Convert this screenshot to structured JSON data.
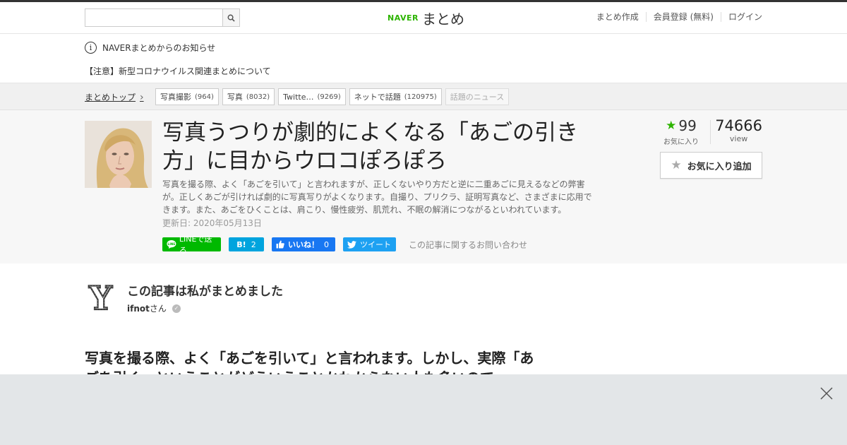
{
  "header": {
    "search_placeholder": "",
    "logo_naver": "NAVER",
    "logo_matome": "まとめ",
    "nav": [
      "まとめ作成",
      "会員登録 (無料)",
      "ログイン"
    ]
  },
  "notice": {
    "info_glyph": "i",
    "heading": "NAVERまとめからのお知らせ",
    "item": "【注意】新型コロナウイルス関連まとめについて"
  },
  "breadcrumb": {
    "top": "まとめトップ",
    "tags": [
      {
        "label": "写真撮影",
        "count": "(964)"
      },
      {
        "label": "写真",
        "count": "(8032)"
      },
      {
        "label": "Twitte…",
        "count": "(9269)"
      },
      {
        "label": "ネットで話題",
        "count": "(120975)"
      },
      {
        "label": "話題のニュース",
        "count": ""
      }
    ]
  },
  "article": {
    "title": "写真うつりが劇的によくなる「あごの引き方」に目からウロコぽろぽろ",
    "description": "写真を撮る際、よく「あごを引いて」と言われますが、正しくないやり方だと逆に二重あごに見えるなどの弊害が。正しくあごが引ければ劇的に写真写りがよくなります。自撮り、プリクラ、証明写真など、さまざまに応用できます。また、あごをひくことは、肩こり、慢性疲労、肌荒れ、不眠の解消につながるといわれています。",
    "updated": "更新日: 2020年05月13日",
    "favorites": "99",
    "favorites_label": "お気に入り",
    "views": "74666",
    "views_label": "view",
    "fav_button": "お気に入り追加"
  },
  "social": {
    "line": "LINEで送る",
    "hatena_mark": "B!",
    "hatena_count": "2",
    "fb_label": "いいね！",
    "fb_count": "0",
    "tweet": "ツイート",
    "inquiry": "この記事に関するお問い合わせ"
  },
  "curator": {
    "heading": "この記事は私がまとめました",
    "name": "ifnot",
    "suffix": "さん",
    "check_glyph": "✓",
    "avatar_letter": "Y"
  },
  "body": {
    "lead": "写真を撮る際、よく「あごを引いて」と言われます。しかし、実際「あごを引く」ということがどういうことかわからない人も多いので"
  },
  "colors": {
    "brand_green": "#2db400",
    "line_green": "#00b900",
    "hatena_blue": "#00a4de",
    "facebook_blue": "#1877f2",
    "twitter_blue": "#1da1f2"
  }
}
